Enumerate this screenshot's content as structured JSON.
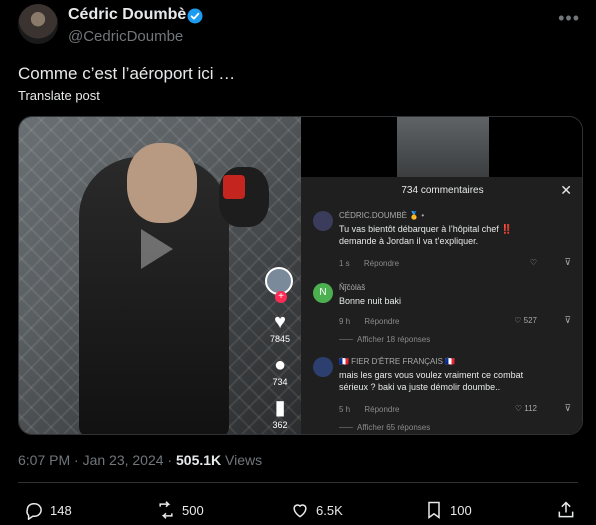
{
  "author": {
    "name": "Cédric Doumbè",
    "handle": "@CedricDoumbe",
    "verified_color": "#1d9bf0"
  },
  "tweet": {
    "text": "Comme c’est l’aéroport ici …",
    "translate_label": "Translate post"
  },
  "video": {
    "tiktok_rail": {
      "likes": "7845",
      "comments": "734",
      "saves": "362"
    },
    "comments_panel": {
      "title": "734 commentaires",
      "close_icon": "close-icon",
      "comments": [
        {
          "name": "CÉDRIC.DOUMBÈ 🥇 •",
          "text": "Tu vas bientôt débarquer à l’hôpital chef ‼️ demande à Jordan il va t’expliquer.",
          "time": "1 s",
          "reply_label": "Répondre",
          "likes": "",
          "replies": ""
        },
        {
          "name": "Ňĵčòlàš",
          "text": "Bonne nuit baki",
          "time": "9 h",
          "reply_label": "Répondre",
          "likes": "527",
          "replies": "Afficher 18 réponses"
        },
        {
          "name": "🇫🇷 FIER D'ÊTRE FRANÇAIS 🇫🇷",
          "text": "mais les gars vous voulez vraiment ce combat sérieux ? baki va juste démolir doumbe..",
          "time": "5 h",
          "reply_label": "Répondre",
          "likes": "112",
          "replies": "Afficher 65 réponses"
        }
      ]
    }
  },
  "meta": {
    "time": "6:07 PM · Jan 23, 2024",
    "separator": " · ",
    "views_count": "505.1K",
    "views_label": " Views"
  },
  "actions": {
    "replies": "148",
    "reposts": "500",
    "likes": "6.5K",
    "bookmarks": "100"
  }
}
